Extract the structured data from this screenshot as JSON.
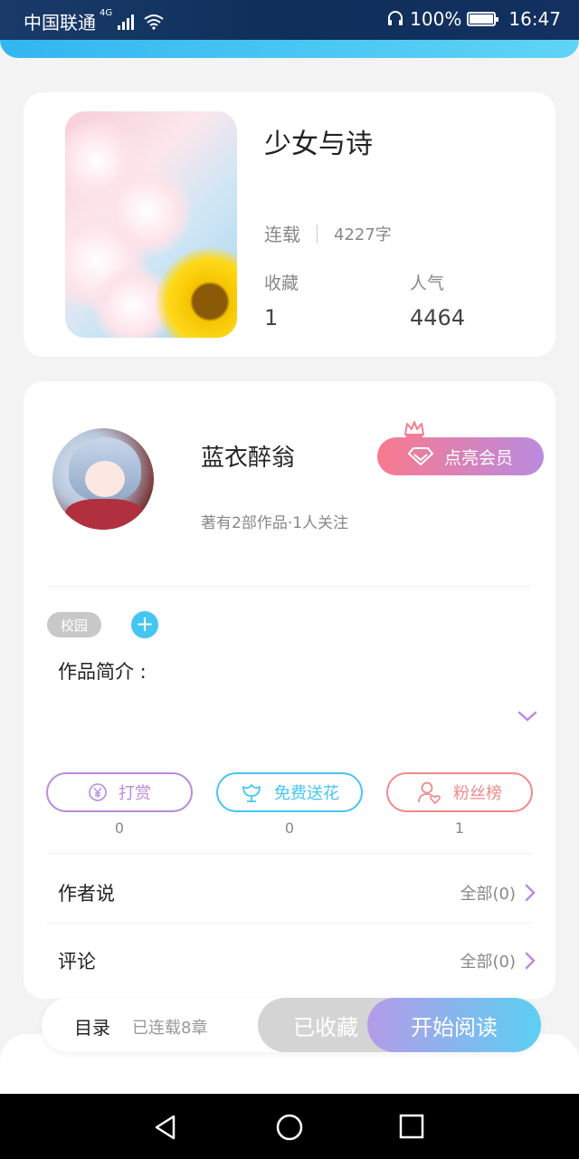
{
  "status_bar": {
    "carrier": "中国联通",
    "network": "4G",
    "battery": "100%",
    "time": "16:47",
    "icons": [
      "signal-icon",
      "wifi-icon",
      "headphone-icon",
      "battery-icon"
    ]
  },
  "book": {
    "title": "少女与诗",
    "status": "连载",
    "word_count": "4227字",
    "stats": [
      {
        "label": "收藏",
        "value": "1"
      },
      {
        "label": "人气",
        "value": "4464"
      }
    ]
  },
  "author": {
    "name": "蓝衣醉翁",
    "subtitle": "著有2部作品·1人关注",
    "vip_button": "点亮会员"
  },
  "tags": [
    "校园"
  ],
  "add_tag": "+",
  "intro_label": "作品简介 :",
  "actions": [
    {
      "label": "打赏",
      "count": "0",
      "icon": "yen-coin-icon",
      "color": "#b98be0"
    },
    {
      "label": "免费送花",
      "count": "0",
      "icon": "flower-icon",
      "color": "#45c6f2"
    },
    {
      "label": "粉丝榜",
      "count": "1",
      "icon": "fan-user-icon",
      "color": "#f08a8a"
    }
  ],
  "rows": [
    {
      "title": "作者说",
      "more": "全部(0)"
    },
    {
      "title": "评论",
      "more": "全部(0)"
    }
  ],
  "bottom": {
    "toc": "目录",
    "toc_sub": "已连载8章",
    "collected": "已收藏",
    "read": "开始阅读"
  },
  "colors": {
    "accent_blue": "#45c6f2",
    "accent_purple": "#b98be0",
    "accent_pink": "#f87a8e"
  }
}
